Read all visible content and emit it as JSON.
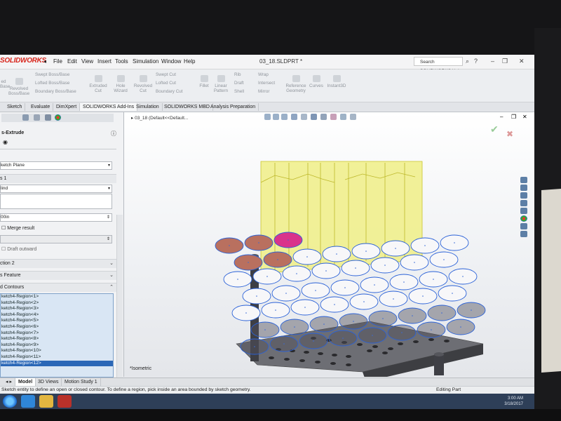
{
  "app": {
    "logo": "SOLIDWORKS",
    "menu": [
      "File",
      "Edit",
      "View",
      "Insert",
      "Tools",
      "Simulation",
      "Window",
      "Help"
    ],
    "document_title": "03_18.SLDPRT *",
    "search_placeholder": "Search SOLIDWORKS Help"
  },
  "ribbon": {
    "left_labels": [
      "Swept Boss/Base",
      "Lofted Boss/Base",
      "Boundary Boss/Base"
    ],
    "left_partials": [
      "ed",
      "Base"
    ],
    "revolved_boss": "Revolved Boss/Base",
    "extruded_cut": "Extruded Cut",
    "hole_wizard": "Hole Wizard",
    "revolved_cut": "Revolved Cut",
    "cut_labels": [
      "Swept Cut",
      "Lofted Cut",
      "Boundary Cut"
    ],
    "fillet": "Fillet",
    "linear_pattern": "Linear Pattern",
    "rib": "Rib",
    "draft": "Draft",
    "shell": "Shell",
    "wrap": "Wrap",
    "intersect": "Intersect",
    "mirror": "Mirror",
    "reference_geometry": "Reference Geometry",
    "curves": "Curves",
    "instant3d": "Instant3D"
  },
  "command_tabs": [
    "Sketch",
    "Evaluate",
    "DimXpert",
    "SOLIDWORKS Add-Ins",
    "Simulation",
    "SOLIDWORKS MBD",
    "Analysis Preparation"
  ],
  "feature_manager": {
    "title": "s-Extrude",
    "from_value": "ketch Plane",
    "direction_label": "s 1",
    "end_condition": "lind",
    "depth_value": "00in",
    "merge_result": "Merge result",
    "draft_outward": "Draft outward",
    "direction2": "ction 2",
    "thin_feature": "s Feature",
    "selected_contours": "d Contours",
    "regions": [
      "ketch4-Region<1>",
      "ketch4-Region<2>",
      "ketch4-Region<3>",
      "ketch4-Region<4>",
      "ketch4-Region<5>",
      "ketch4-Region<6>",
      "ketch4-Region<7>",
      "ketch4-Region<8>",
      "ketch4-Region<9>",
      "ketch4-Region<10>",
      "ketch4-Region<11>",
      "ketch4-Region<12>"
    ],
    "selected_region_index": 11
  },
  "viewport": {
    "breadcrumb": "03_18  (Default<<Default...",
    "view_label": "*Isometric"
  },
  "bottom_tabs": [
    "Model",
    "3D Views",
    "Motion Study 1"
  ],
  "status_bar": {
    "message": "Sketch entity to define an open or closed contour. To define a region, pick inside an area bounded by sketch geometry.",
    "mode": "Editing Part"
  },
  "taskbar": {
    "time": "3:00 AM",
    "date": "3/18/2017"
  },
  "colors": {
    "accent_blue": "#2a67b7",
    "solidworks_red": "#d9261c",
    "extrude_yellow": "#eaea55",
    "sketch_blue": "#2b62d8"
  }
}
